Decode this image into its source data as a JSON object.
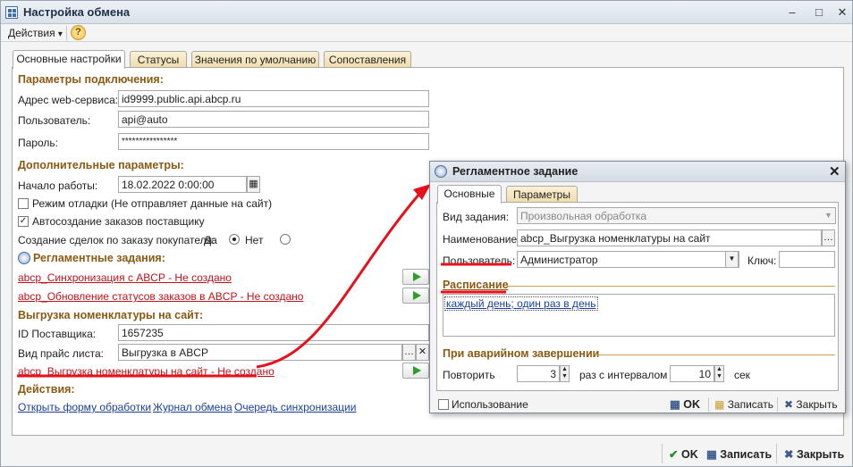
{
  "window": {
    "title": "Настройка обмена"
  },
  "toolbar": {
    "actions_label": "Действия",
    "actions_arrow": "▾",
    "help_glyph": "?"
  },
  "tabs": [
    "Основные настройки",
    "Статусы",
    "Значения по умолчанию",
    "Сопоставления"
  ],
  "connection": {
    "header": "Параметры подключения:",
    "url_label": "Адрес web-сервиса:",
    "url_value": "id9999.public.api.abcp.ru",
    "user_label": "Пользователь:",
    "user_value": "api@auto",
    "password_label": "Пароль:",
    "password_value": "****************"
  },
  "extra": {
    "header": "Дополнительные параметры:",
    "start_label": "Начало работы:",
    "start_value": "18.02.2022  0:00:00",
    "debug_label": "Режим отладки (Не отправляет данные на сайт)",
    "debug_checked": false,
    "auto_label": "Автосоздание заказов поставщику",
    "auto_checked": true,
    "deals_label": "Создание сделок по заказу покупателя:",
    "deals_yes": "Да",
    "deals_no": "Нет",
    "deals_selected": "Да"
  },
  "scheduled": {
    "header": "Регламентные задания:",
    "task1": "abcp_Синхронизация с ABCP - Не создано",
    "task2": "abcp_Обновление статусов заказов в ABCP - Не создано"
  },
  "export": {
    "header": "Выгрузка номенклатуры на сайт:",
    "supplier_label": "ID Поставщика:",
    "supplier_value": "1657235",
    "pricelist_label": "Вид прайс листа:",
    "pricelist_value": "Выгрузка в ABCP",
    "task": "abcp_Выгрузка номенклатуры на сайт - Не создано"
  },
  "actions": {
    "header": "Действия:",
    "open_form": "Открыть форму обработки",
    "log": "Журнал обмена",
    "queue": "Очередь синхронизации"
  },
  "footer": {
    "ok": "OK",
    "save": "Записать",
    "close": "Закрыть"
  },
  "dialog": {
    "title": "Регламентное задание",
    "tabs": [
      "Основные",
      "Параметры"
    ],
    "kind_label": "Вид задания:",
    "kind_value": "Произвольная обработка",
    "name_label": "Наименование:",
    "name_value": "abcp_Выгрузка номенклатуры на сайт",
    "user_label": "Пользователь:",
    "user_value": "Администратор",
    "key_label": "Ключ:",
    "key_value": "",
    "schedule_header": "Расписание",
    "schedule_value": "каждый день; один раз в день",
    "crash_header": "При аварийном завершении",
    "repeat_label": "Повторить",
    "repeat_value": "3",
    "interval_label": "раз с интервалом",
    "interval_value": "10",
    "sec_label": "сек",
    "usage_label": "Использование",
    "usage_checked": false,
    "ok": "OK",
    "save": "Записать",
    "close": "Закрыть"
  },
  "colors": {
    "section": "#8a5a12",
    "link_red": "#c0111a",
    "link_blue": "#1a3f9c",
    "annotation": "#e8101a"
  }
}
